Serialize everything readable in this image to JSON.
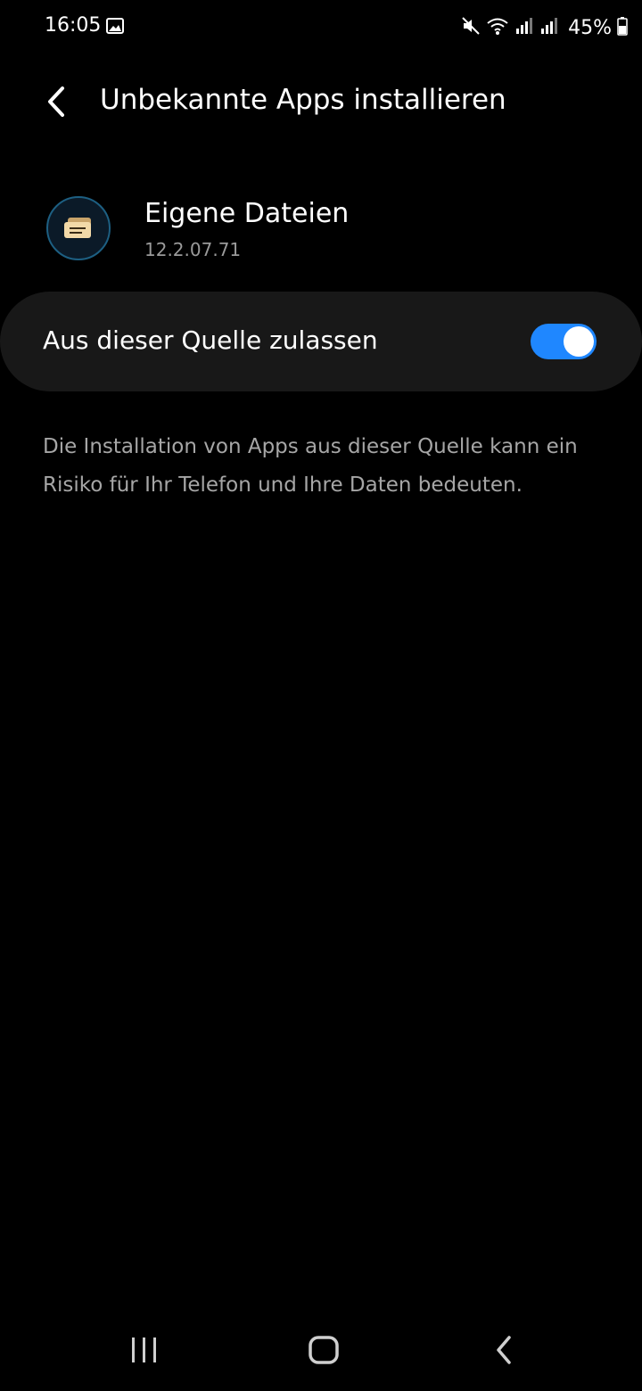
{
  "status_bar": {
    "time": "16:05",
    "battery": "45%",
    "icons": [
      "gallery-icon",
      "mute-icon",
      "wifi-icon",
      "signal-icon",
      "signal-icon",
      "battery-icon"
    ]
  },
  "header": {
    "title": "Unbekannte Apps installieren",
    "back_icon": "chevron-left-icon"
  },
  "app": {
    "name": "Eigene Dateien",
    "version": "12.2.07.71",
    "icon": "my-files-icon"
  },
  "toggle": {
    "label": "Aus dieser Quelle zulassen",
    "enabled": true
  },
  "warning": {
    "text": "Die Installation von Apps aus dieser Quelle kann ein Risiko für Ihr Telefon und Ihre Daten bedeuten."
  },
  "nav_bar": {
    "items": [
      "recents-icon",
      "home-icon",
      "back-icon"
    ]
  },
  "colors": {
    "background": "#000000",
    "card": "#181818",
    "accent": "#1f87ff",
    "secondary_text": "#a6a6a6"
  }
}
